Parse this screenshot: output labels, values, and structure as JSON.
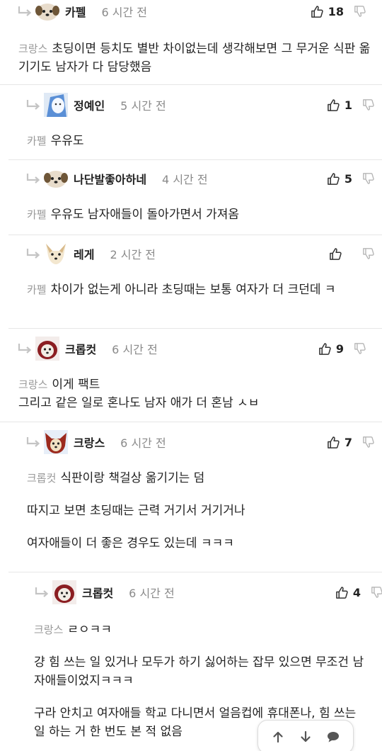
{
  "comments": [
    {
      "nickname": "카펠",
      "time": "6 시간 전",
      "likes": "18",
      "mention": "크랑스",
      "paragraphs": [
        "초딩이면 등치도 별반 차이없는데 생각해보면 그 무거운 식판 옮기기도 남자가 다 담당했음"
      ]
    },
    {
      "nickname": "정예인",
      "time": "5 시간 전",
      "likes": "1",
      "mention": "카펠",
      "paragraphs": [
        "우유도"
      ]
    },
    {
      "nickname": "나단발좋아하네",
      "time": "4 시간 전",
      "likes": "5",
      "mention": "카펠",
      "paragraphs": [
        "우유도 남자애들이 돌아가면서 가져옴"
      ]
    },
    {
      "nickname": "레게",
      "time": "2 시간 전",
      "likes": "",
      "mention": "카펠",
      "paragraphs": [
        "차이가 없는게 아니라 초딩때는 보통 여자가 더 크던데 ㅋ"
      ]
    },
    {
      "nickname": "크롭컷",
      "time": "6 시간 전",
      "likes": "9",
      "mention": "크랑스",
      "paragraphs": [
        "이게 팩트",
        "그리고 같은 일로 혼나도 남자 애가 더 혼남 ㅅㅂ"
      ]
    },
    {
      "nickname": "크랑스",
      "time": "6 시간 전",
      "likes": "7",
      "mention": "크롭컷",
      "paragraphs": [
        "식판이랑 책걸상 옮기기는 덤",
        "따지고 보면 초딩때는 근력 거기서 거기거나",
        "여자애들이 더 좋은 경우도 있는데 ㅋㅋㅋ"
      ]
    },
    {
      "nickname": "크롭컷",
      "time": "6 시간 전",
      "likes": "4",
      "mention": "크랑스",
      "paragraphs": [
        "ㄹㅇㅋㅋ",
        "걍 힘 쓰는 일 있거나 모두가 하기 싫어하는 잡무 있으면 무조건 남자애들이었지ㅋㅋㅋ",
        "구라 안치고 여자애들 학교 다니면서 얼음컵에 휴대폰나, 힘 쓰는 일 하는 거 한 번도 본 적 없음"
      ]
    }
  ],
  "colors": {
    "meta": "#8a8a8a",
    "mention": "#9a9a9a",
    "text": "#222222",
    "divider": "#e6e6e6"
  },
  "icons": {
    "reply": "reply-arrow-icon",
    "like": "thumbs-up-icon",
    "dislike": "thumbs-down-icon",
    "fab": [
      "arrow-up-icon",
      "arrow-down-icon",
      "speech-bubble-icon"
    ]
  }
}
